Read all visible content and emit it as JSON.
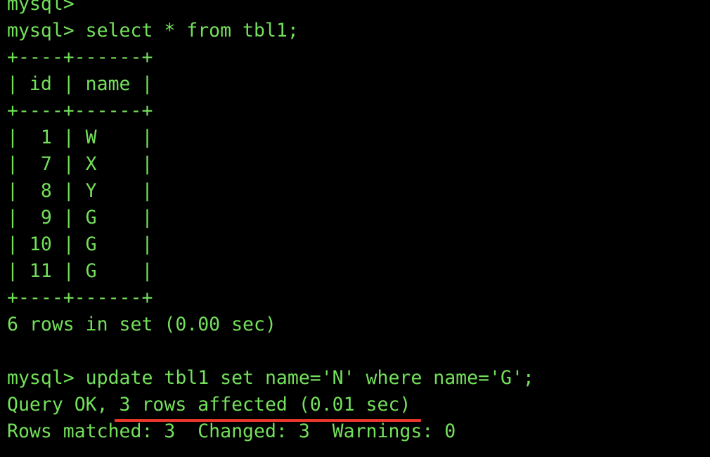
{
  "terminal": {
    "lines": [
      "mysql>",
      "mysql> select * from tbl1;",
      "+----+------+",
      "| id | name |",
      "+----+------+",
      "|  1 | W    |",
      "|  7 | X    |",
      "|  8 | Y    |",
      "|  9 | G    |",
      "| 10 | G    |",
      "| 11 | G    |",
      "+----+------+",
      "6 rows in set (0.00 sec)",
      "",
      "mysql> update tbl1 set name='N' where name='G';",
      "Query OK, 3 rows affected (0.01 sec)",
      "Rows matched: 3  Changed: 3  Warnings: 0"
    ]
  },
  "colors": {
    "background": "#000000",
    "text": "#73e05a",
    "annotation_underline": "#e8352b"
  }
}
